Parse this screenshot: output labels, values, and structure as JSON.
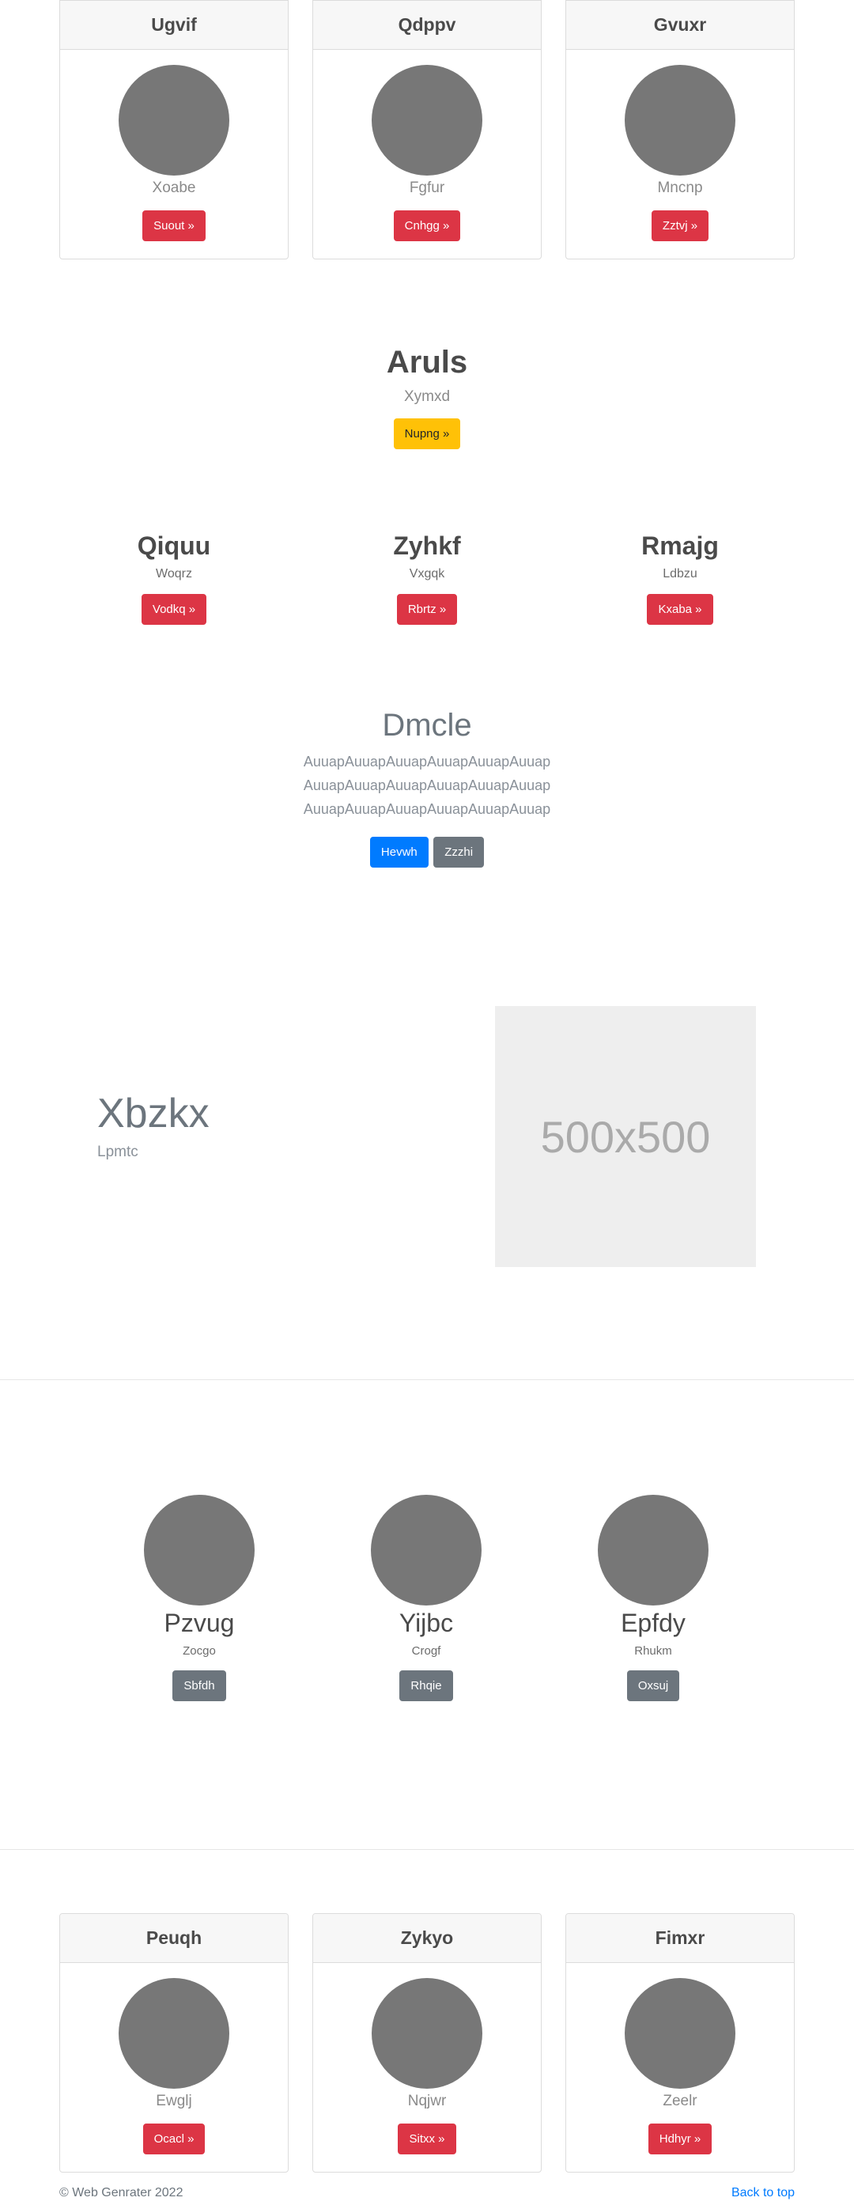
{
  "top_cards": [
    {
      "title": "Ugvif",
      "subtitle": "Xoabe",
      "button": "Suout »"
    },
    {
      "title": "Qdppv",
      "subtitle": "Fgfur",
      "button": "Cnhgg »"
    },
    {
      "title": "Gvuxr",
      "subtitle": "Mncnp",
      "button": "Zztvj »"
    }
  ],
  "hero": {
    "title": "Aruls",
    "subtitle": "Xymxd",
    "button": "Nupng »"
  },
  "trio": [
    {
      "title": "Qiquu",
      "subtitle": "Woqrz",
      "button": "Vodkq »"
    },
    {
      "title": "Zyhkf",
      "subtitle": "Vxgqk",
      "button": "Rbrtz »"
    },
    {
      "title": "Rmajg",
      "subtitle": "Ldbzu",
      "button": "Kxaba »"
    }
  ],
  "jumbotron": {
    "title": "Dmcle",
    "lines": [
      "AuuapAuuapAuuapAuuapAuuapAuuap",
      "AuuapAuuapAuuapAuuapAuuapAuuap",
      "AuuapAuuapAuuapAuuapAuuapAuuap"
    ],
    "primary_button": "Hevwh",
    "secondary_button": "Zzzhi"
  },
  "feature": {
    "title": "Xbzkx",
    "subtitle": "Lpmtc",
    "image_label": "500x500"
  },
  "circles": [
    {
      "title": "Pzvug",
      "subtitle": "Zocgo",
      "button": "Sbfdh"
    },
    {
      "title": "Yijbc",
      "subtitle": "Crogf",
      "button": "Rhqie"
    },
    {
      "title": "Epfdy",
      "subtitle": "Rhukm",
      "button": "Oxsuj"
    }
  ],
  "bottom_cards": [
    {
      "title": "Peuqh",
      "subtitle": "Ewglj",
      "button": "Ocacl »"
    },
    {
      "title": "Zykyo",
      "subtitle": "Nqjwr",
      "button": "Sitxx »"
    },
    {
      "title": "Fimxr",
      "subtitle": "Zeelr",
      "button": "Hdhyr »"
    }
  ],
  "footer": {
    "copyright": "© Web Genrater 2022",
    "back_to_top": "Back to top"
  },
  "colors": {
    "danger": "#dc3545",
    "warning": "#ffc107",
    "primary": "#007bff",
    "secondary": "#6c757d",
    "avatar": "#777777"
  }
}
